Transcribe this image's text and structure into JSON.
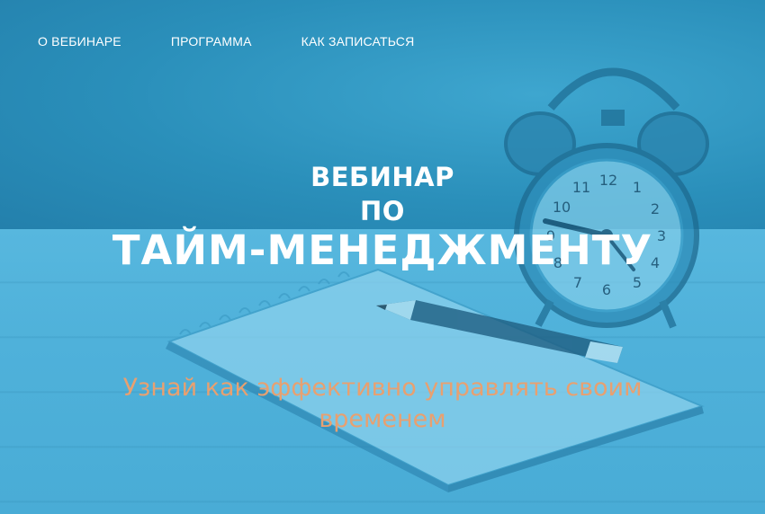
{
  "nav": {
    "items": [
      {
        "label": "О ВЕБИНАРЕ"
      },
      {
        "label": "ПРОГРАММА"
      },
      {
        "label": "КАК ЗАПИСАТЬСЯ"
      }
    ]
  },
  "hero": {
    "title_line1": "ВЕБИНАР",
    "title_line2": "ПО",
    "title_line3": "ТАЙМ-МЕНЕДЖМЕНТУ",
    "subtitle": "Узнай как эффективно управлять своим временем"
  },
  "colors": {
    "overlay": "#2f9cc6",
    "text": "#ffffff",
    "accent": "#e8a070"
  },
  "clock": {
    "numbers": [
      "12",
      "1",
      "2",
      "3",
      "4",
      "5",
      "6",
      "7",
      "8",
      "9",
      "10",
      "11"
    ]
  }
}
